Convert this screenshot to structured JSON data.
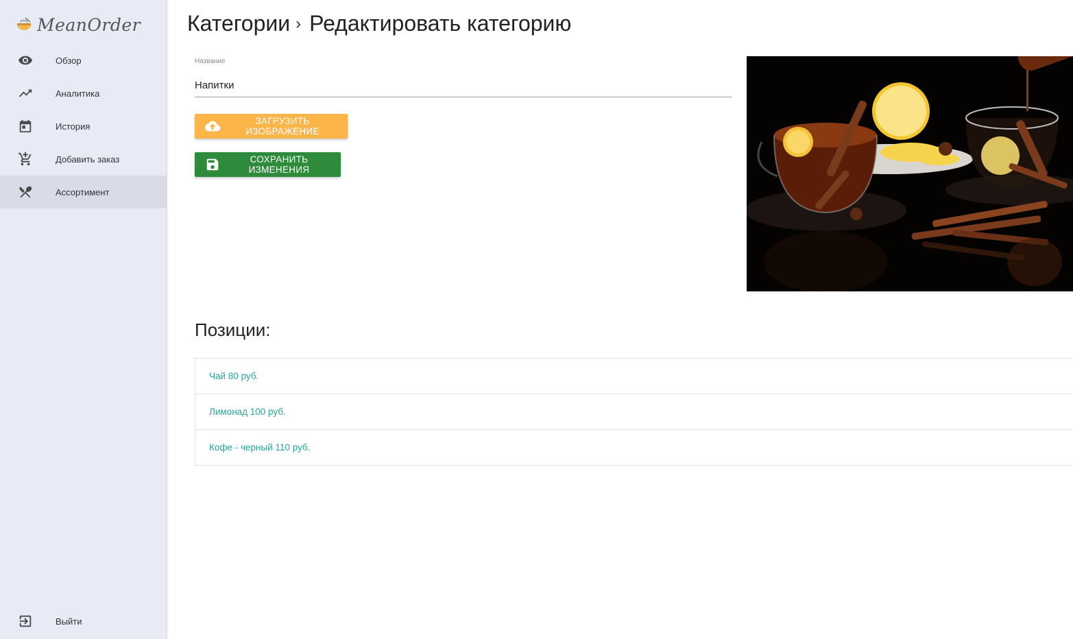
{
  "app": {
    "brand": "MeanOrder"
  },
  "sidebar": {
    "items": [
      {
        "label": "Обзор",
        "icon": "eye-icon"
      },
      {
        "label": "Аналитика",
        "icon": "trending-up-icon"
      },
      {
        "label": "История",
        "icon": "calendar-icon"
      },
      {
        "label": "Добавить заказ",
        "icon": "add-cart-icon"
      },
      {
        "label": "Ассортимент",
        "icon": "utensils-icon",
        "active": true
      }
    ],
    "logout": {
      "label": "Выйти",
      "icon": "logout-icon"
    }
  },
  "breadcrumb": {
    "parent": "Категории",
    "separator": "›",
    "current": "Редактировать категорию"
  },
  "form": {
    "name_label": "Название",
    "name_value": "Напитки",
    "upload_button": "ЗАГРУЗИТЬ ИЗОБРАЖЕНИЕ",
    "save_button": "СОХРАНИТЬ ИЗМЕНЕНИЯ"
  },
  "positions": {
    "title": "Позиции:",
    "items": [
      {
        "label": "Чай 80 руб."
      },
      {
        "label": "Лимонад 100 руб."
      },
      {
        "label": "Кофе - черный 110 руб."
      }
    ]
  },
  "colors": {
    "sidebar_bg": "#e8eaf6",
    "upload_button": "#fbb549",
    "save_button": "#2e8b3b",
    "position_link": "#26a69a"
  }
}
